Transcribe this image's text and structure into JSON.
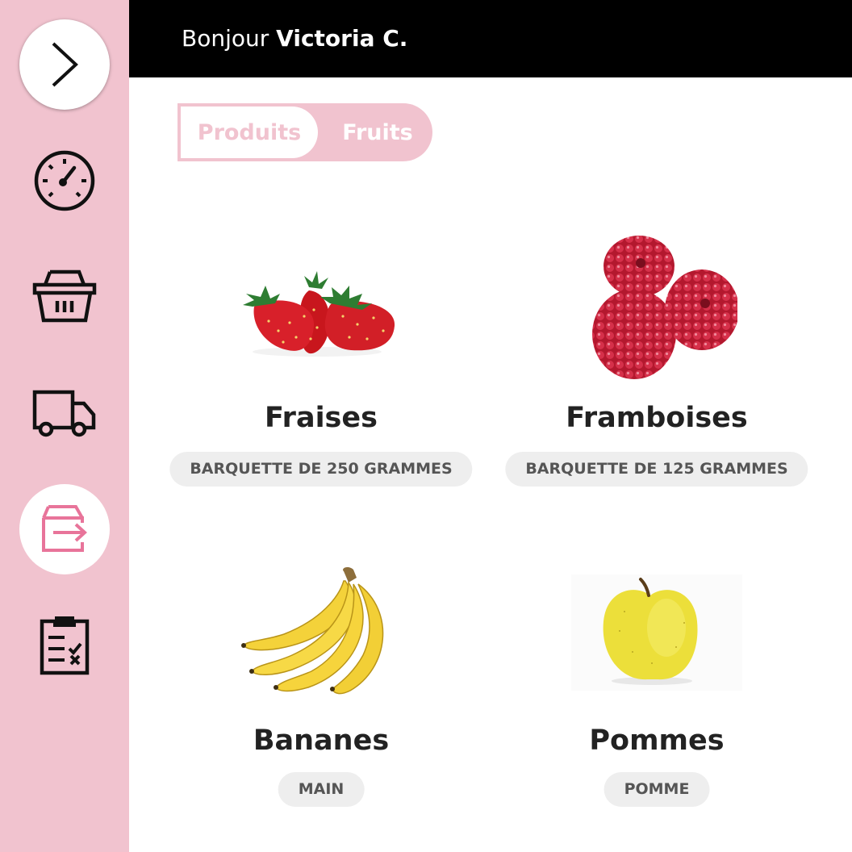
{
  "header": {
    "greeting": "Bonjour",
    "user_name": "Victoria C."
  },
  "breadcrumb": [
    "Produits",
    "Fruits"
  ],
  "sidebar": {
    "items": [
      {
        "icon": "chevron-right-icon",
        "state": "toggle"
      },
      {
        "icon": "dashboard-gauge-icon"
      },
      {
        "icon": "basket-icon"
      },
      {
        "icon": "delivery-truck-icon"
      },
      {
        "icon": "box-export-icon",
        "active": true
      },
      {
        "icon": "checklist-clipboard-icon"
      }
    ],
    "active_color": "#e8749a"
  },
  "products": [
    {
      "name": "Fraises",
      "unit": "BARQUETTE DE 250 GRAMMES",
      "image": "strawberries"
    },
    {
      "name": "Framboises",
      "unit": "BARQUETTE DE 125 GRAMMES",
      "image": "raspberries"
    },
    {
      "name": "Bananes",
      "unit": "MAIN",
      "image": "bananas"
    },
    {
      "name": "Pommes",
      "unit": "POMME",
      "image": "apple"
    }
  ],
  "colors": {
    "sidebar_bg": "#f1c3cf",
    "header_bg": "#000000",
    "pill_bg": "#eeeeee"
  }
}
